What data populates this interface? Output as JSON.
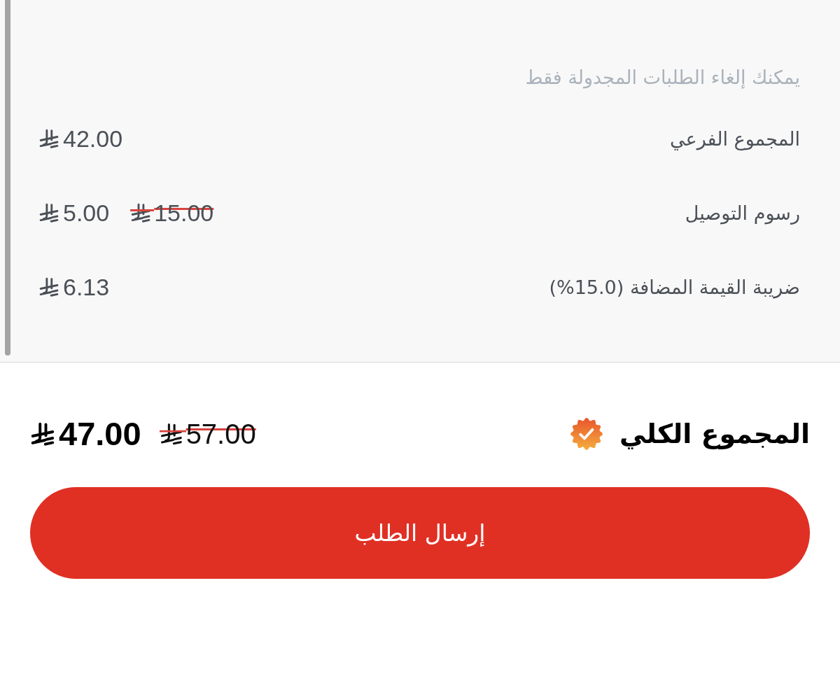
{
  "note": "يمكنك إلغاء الطلبات المجدولة فقط",
  "lines": [
    {
      "label": "المجموع الفرعي",
      "amount": "42.00"
    },
    {
      "label": "رسوم التوصيل",
      "amount": "5.00",
      "original_amount": "15.00"
    },
    {
      "label": "ضريبة القيمة المضافة (15.0%)",
      "amount": "6.13"
    }
  ],
  "total": {
    "label": "المجموع الكلي",
    "amount": "47.00",
    "original_amount": "57.00"
  },
  "submit_button": {
    "label": "إرسال الطلب"
  }
}
